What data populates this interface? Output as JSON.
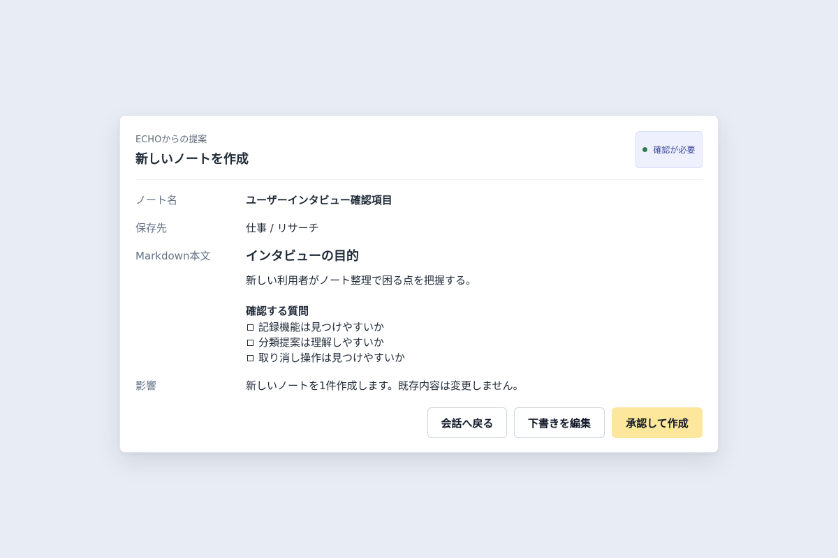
{
  "card": {
    "eyebrow": "ECHOからの提案",
    "title": "新しいノートを作成",
    "status": {
      "label": "確認が必要",
      "dot_color": "#2f7d4f"
    }
  },
  "fields": {
    "note_name": {
      "label": "ノート名",
      "value": "ユーザーインタビュー確認項目"
    },
    "destination": {
      "label": "保存先",
      "value": "仕事 / リサーチ"
    },
    "markdown": {
      "label": "Markdown本文",
      "heading": "インタビューの目的",
      "paragraph": "新しい利用者がノート整理で困る点を把握する。",
      "subheading": "確認する質問",
      "checklist": [
        "記録機能は見つけやすいか",
        "分類提案は理解しやすいか",
        "取り消し操作は見つけやすいか"
      ],
      "checkbox_icon": "checkbox-empty-icon"
    },
    "impact": {
      "label": "影響",
      "value": "新しいノートを1件作成します。既存内容は変更しません。"
    }
  },
  "actions": {
    "back_label": "会話へ戻る",
    "edit_label": "下書きを編集",
    "approve_label": "承認して作成",
    "approve_color": "#fde79c"
  }
}
